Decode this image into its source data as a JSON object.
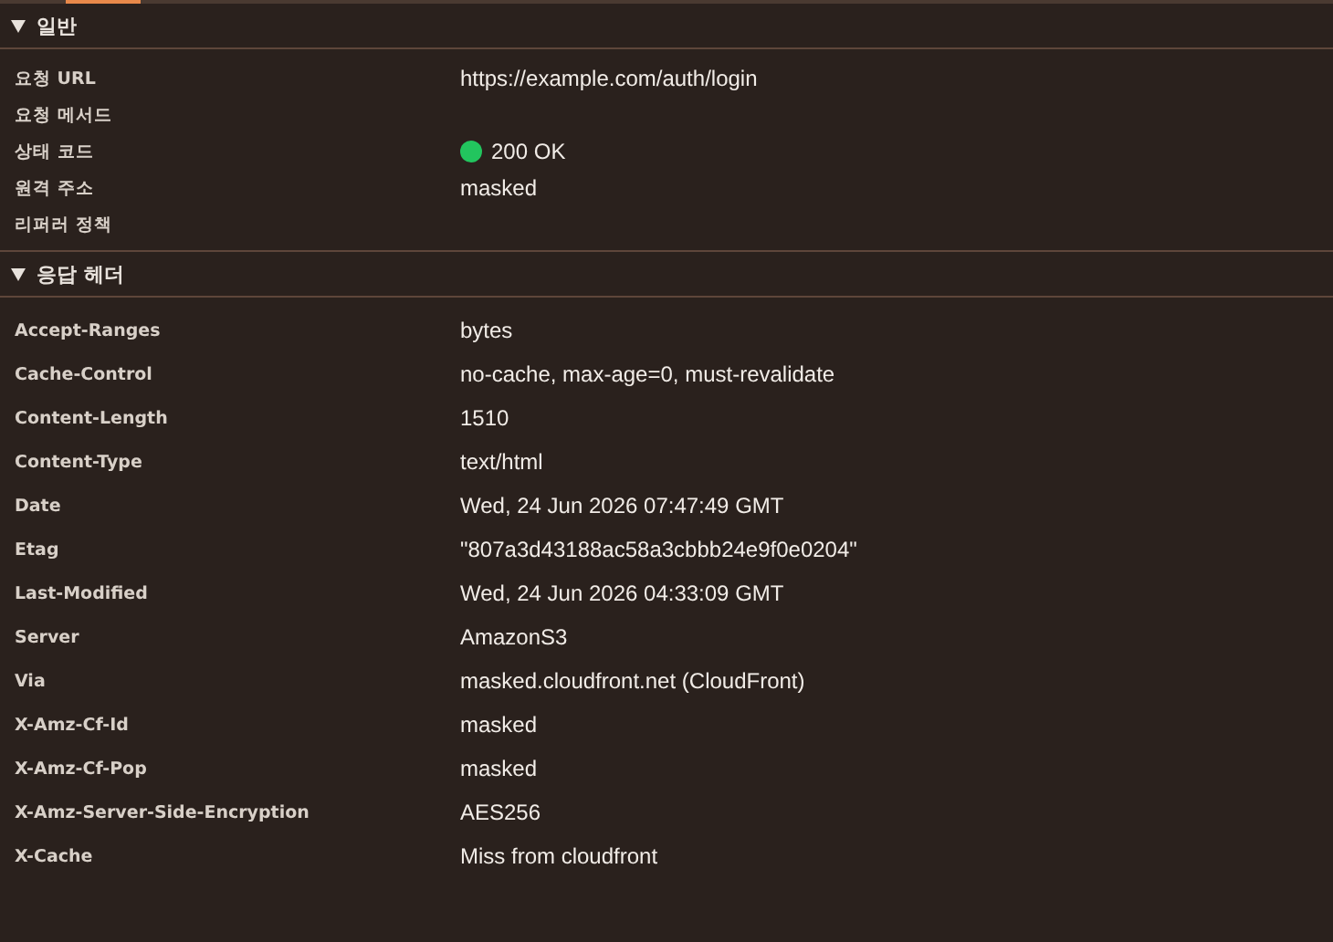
{
  "sections": [
    {
      "title": "일반",
      "expanded": true,
      "kind": "summary",
      "rows": [
        {
          "label": "요청 URL",
          "value": "https://example.com/auth/login"
        },
        {
          "label": "요청 메서드"
        },
        {
          "label": "상태 코드",
          "value": "200 OK",
          "color": "#22c55e"
        },
        {
          "label": "원격 주소",
          "value": "masked"
        },
        {
          "label": "리퍼러 정책"
        }
      ]
    },
    {
      "title": "응답 헤더",
      "expanded": true,
      "kind": "headers",
      "rows": [
        {
          "label": "Accept-Ranges",
          "value": "bytes"
        },
        {
          "label": "Cache-Control",
          "value": "no-cache, max-age=0, must-revalidate"
        },
        {
          "label": "Content-Length",
          "value": "1510"
        },
        {
          "label": "Content-Type",
          "value": "text/html"
        },
        {
          "label": "Date",
          "value": "Wed, 24 Jun 2026 07:47:49 GMT"
        },
        {
          "label": "Etag",
          "value": "\"807a3d43188ac58a3cbbb24e9f0e0204\""
        },
        {
          "label": "Last-Modified",
          "value": "Wed, 24 Jun 2026 04:33:09 GMT"
        },
        {
          "label": "Server",
          "value": "AmazonS3"
        },
        {
          "label": "Via",
          "value": "masked.cloudfront.net (CloudFront)"
        },
        {
          "label": "X-Amz-Cf-Id",
          "value": "masked"
        },
        {
          "label": "X-Amz-Cf-Pop",
          "value": "masked"
        },
        {
          "label": "X-Amz-Server-Side-Encryption",
          "value": "AES256"
        },
        {
          "label": "X-Cache",
          "value": "Miss from cloudfront"
        }
      ]
    }
  ]
}
